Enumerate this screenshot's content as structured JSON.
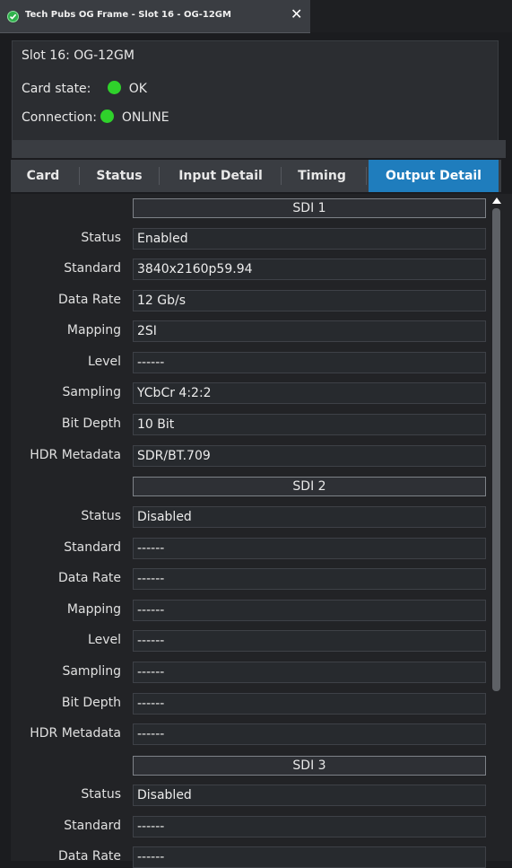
{
  "window": {
    "tab_title": "Tech Pubs OG Frame - Slot 16 - OG-12GM",
    "tab_close": "✕"
  },
  "info": {
    "slot": "Slot 16: OG-12GM",
    "card_state_label": "Card state:",
    "card_state_value": "OK",
    "connection_label": "Connection:",
    "connection_value": "ONLINE"
  },
  "tabs": [
    "Card",
    "Status",
    "Input Detail",
    "Timing",
    "Output Detail"
  ],
  "active_tab": "Output Detail",
  "sections": [
    {
      "title": "SDI 1",
      "rows": [
        {
          "label": "Status",
          "value": "Enabled"
        },
        {
          "label": "Standard",
          "value": "3840x2160p59.94"
        },
        {
          "label": "Data Rate",
          "value": "12 Gb/s"
        },
        {
          "label": "Mapping",
          "value": "2SI"
        },
        {
          "label": "Level",
          "value": "------"
        },
        {
          "label": "Sampling",
          "value": "YCbCr 4:2:2"
        },
        {
          "label": "Bit Depth",
          "value": "10 Bit"
        },
        {
          "label": "HDR Metadata",
          "value": "SDR/BT.709"
        }
      ]
    },
    {
      "title": "SDI 2",
      "rows": [
        {
          "label": "Status",
          "value": "Disabled"
        },
        {
          "label": "Standard",
          "value": "------"
        },
        {
          "label": "Data Rate",
          "value": "------"
        },
        {
          "label": "Mapping",
          "value": "------"
        },
        {
          "label": "Level",
          "value": "------"
        },
        {
          "label": "Sampling",
          "value": "------"
        },
        {
          "label": "Bit Depth",
          "value": "------"
        },
        {
          "label": "HDR Metadata",
          "value": "------"
        }
      ]
    },
    {
      "title": "SDI 3",
      "rows": [
        {
          "label": "Status",
          "value": "Disabled"
        },
        {
          "label": "Standard",
          "value": "------"
        },
        {
          "label": "Data Rate",
          "value": "------"
        }
      ]
    }
  ],
  "colors": {
    "accent_tab": "#1f7dbd",
    "status_ok": "#2fd22b"
  },
  "icons": {
    "tab_status": "check-circle-icon",
    "led": "green-led-icon",
    "scroll": "scroll-up-arrow-icon"
  }
}
